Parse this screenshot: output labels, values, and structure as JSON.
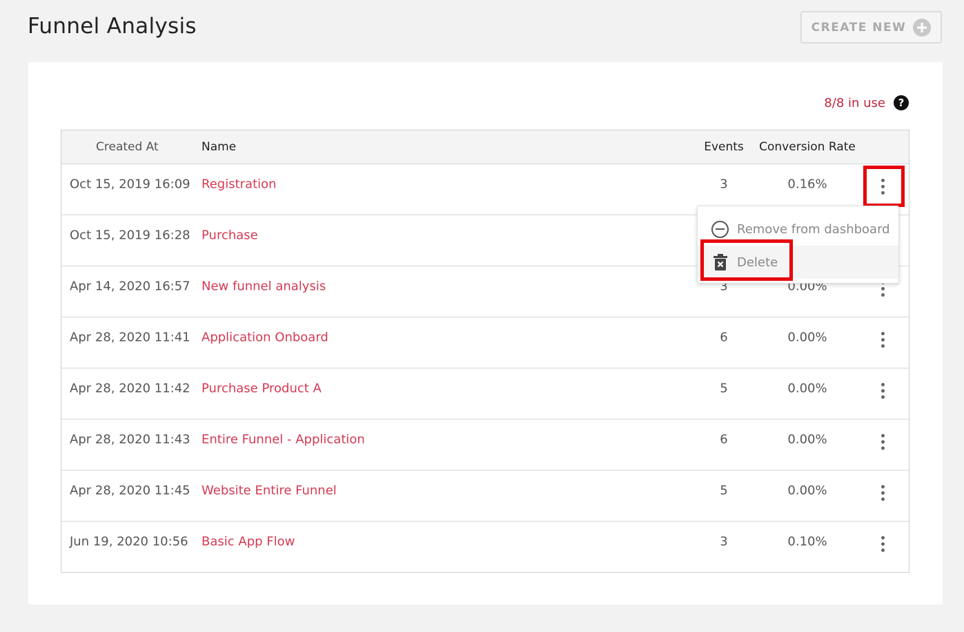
{
  "header": {
    "title": "Funnel Analysis",
    "create_label": "CREATE NEW"
  },
  "usage": {
    "text": "8/8 in use",
    "help_glyph": "?"
  },
  "table": {
    "columns": {
      "created_at": "Created At",
      "name": "Name",
      "events": "Events",
      "conversion_rate": "Conversion Rate"
    },
    "rows": [
      {
        "created_at": "Oct 15, 2019 16:09",
        "name": "Registration",
        "events": "3",
        "conversion_rate": "0.16%"
      },
      {
        "created_at": "Oct 15, 2019 16:28",
        "name": "Purchase",
        "events": "",
        "conversion_rate": ""
      },
      {
        "created_at": "Apr 14, 2020 16:57",
        "name": "New funnel analysis",
        "events": "3",
        "conversion_rate": "0.00%"
      },
      {
        "created_at": "Apr 28, 2020 11:41",
        "name": "Application Onboard",
        "events": "6",
        "conversion_rate": "0.00%"
      },
      {
        "created_at": "Apr 28, 2020 11:42",
        "name": "Purchase Product A",
        "events": "5",
        "conversion_rate": "0.00%"
      },
      {
        "created_at": "Apr 28, 2020 11:43",
        "name": "Entire Funnel - Application",
        "events": "6",
        "conversion_rate": "0.00%"
      },
      {
        "created_at": "Apr 28, 2020 11:45",
        "name": "Website Entire Funnel",
        "events": "5",
        "conversion_rate": "0.00%"
      },
      {
        "created_at": "Jun 19, 2020 10:56",
        "name": "Basic App Flow",
        "events": "3",
        "conversion_rate": "0.10%"
      }
    ]
  },
  "menu": {
    "remove_label": "Remove from dashboard",
    "delete_label": "Delete"
  },
  "colors": {
    "accent": "#d43a52",
    "usage": "#c0263f",
    "highlight": "#e8000b"
  }
}
